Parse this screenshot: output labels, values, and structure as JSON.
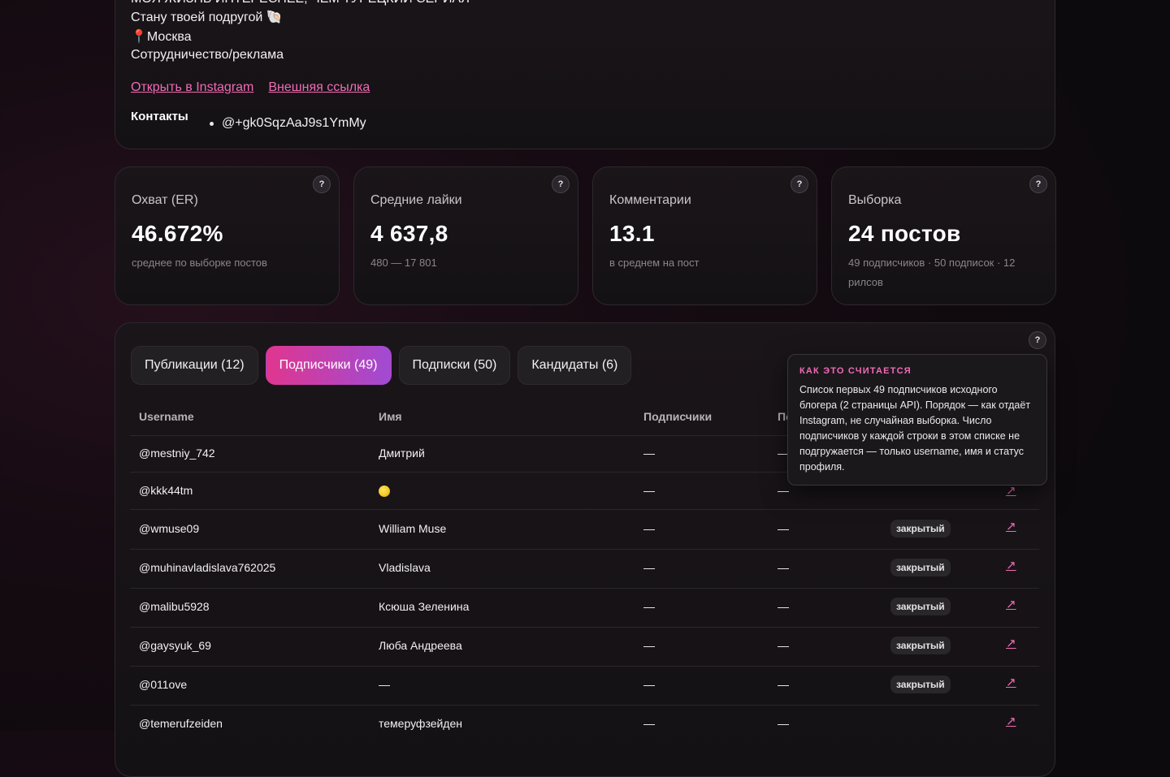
{
  "profile": {
    "bio_clip": "МОЯ ЖИЗНЬ ИНТЕРЕСНЕЕ, ЧЕМ ТУРЕЦКИЙ СЕРИАЛ",
    "bio_line1": "Стану твоей подругой 🐚",
    "bio_line2": "📍Москва",
    "bio_line3": "Сотрудничество/реклама",
    "link_instagram": "Открыть в Instagram",
    "link_external": "Внешняя ссылка",
    "contacts_title": "Контакты",
    "contact_1": "@+gk0SqzAaJ9s1YmMy"
  },
  "stats": [
    {
      "label": "Охват (ER)",
      "value": "46.672%",
      "sub": "среднее по выборке постов",
      "help": "?"
    },
    {
      "label": "Средние лайки",
      "value": "4 637,8",
      "sub": "480 — 17 801",
      "help": "?"
    },
    {
      "label": "Комментарии",
      "value": "13.1",
      "sub": "в среднем на пост",
      "help": "?"
    },
    {
      "label": "Выборка",
      "value": "24 постов",
      "sub": "49 подписчиков · 50 подписок · 12 рилсов",
      "help": "?"
    }
  ],
  "table_help": "?",
  "tabs": [
    {
      "label": "Публикации (12)"
    },
    {
      "label": "Подписчики (49)"
    },
    {
      "label": "Подписки (50)"
    },
    {
      "label": "Кандидаты (6)"
    }
  ],
  "columns": {
    "username": "Username",
    "name": "Имя",
    "followers": "Подписчики",
    "following": "Подписки"
  },
  "rows": [
    {
      "username": "@mestniy_742",
      "name": "Дмитрий",
      "followers": "—",
      "following": "—",
      "status": "",
      "link": "↗"
    },
    {
      "username": "@kkk44tm",
      "name": "",
      "followers": "—",
      "following": "—",
      "status": "",
      "link": "↗"
    },
    {
      "username": "@wmuse09",
      "name": "William Muse",
      "followers": "—",
      "following": "—",
      "status": "закрытый",
      "link": "↗"
    },
    {
      "username": "@muhinavladislava762025",
      "name": "Vladislava",
      "followers": "—",
      "following": "—",
      "status": "закрытый",
      "link": "↗"
    },
    {
      "username": "@malibu5928",
      "name": "Ксюша Зеленина",
      "followers": "—",
      "following": "—",
      "status": "закрытый",
      "link": "↗"
    },
    {
      "username": "@gaysyuk_69",
      "name": "Люба Андреева",
      "followers": "—",
      "following": "—",
      "status": "закрытый",
      "link": "↗"
    },
    {
      "username": "@011ove",
      "name": "—",
      "followers": "—",
      "following": "—",
      "status": "закрытый",
      "link": "↗"
    },
    {
      "username": "@temerufzeiden",
      "name": "темеруфзейден",
      "followers": "—",
      "following": "—",
      "status": "",
      "link": "↗"
    }
  ],
  "tooltip": {
    "title": "КАК ЭТО СЧИТАЕТСЯ",
    "body": "Список первых 49 подписчиков исходного блогера (2 страницы API). Порядок — как отдаёт Instagram, не случайная выборка. Число подписчиков у каждой строки в этом списке не подгружается — только username, имя и статус профиля."
  }
}
